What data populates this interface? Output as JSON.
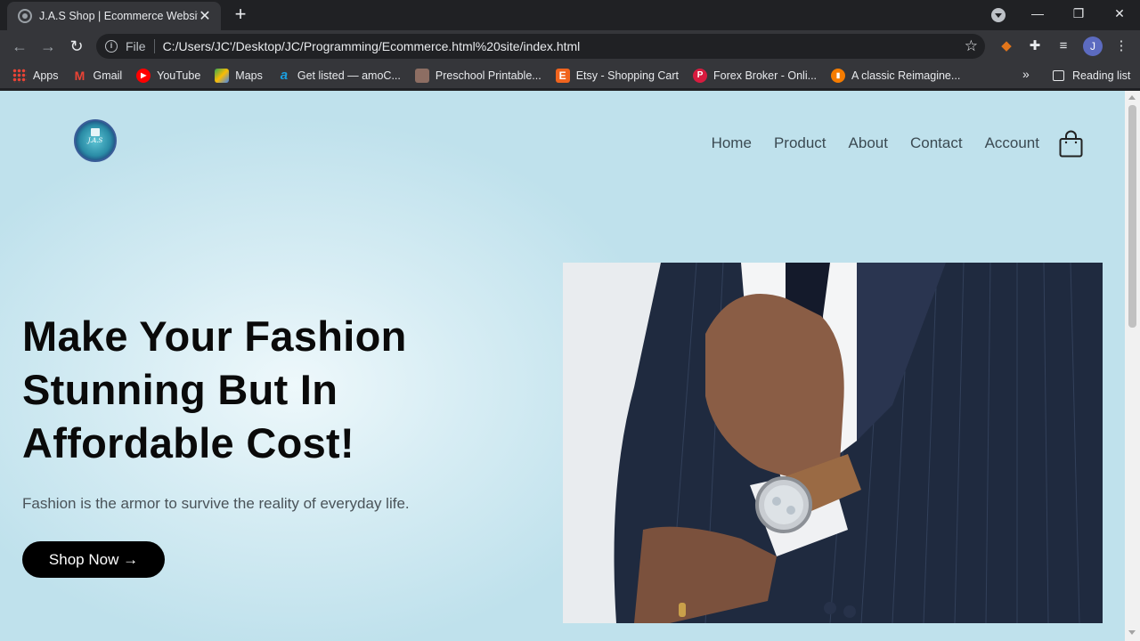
{
  "browser": {
    "tab_title": "J.A.S Shop | Ecommerce Website",
    "tab_close": "✕",
    "new_tab": "+",
    "window_controls": {
      "minimize": "—",
      "restore": "❐",
      "close": "✕"
    },
    "address": {
      "scheme_label": "File",
      "url": "C:/Users/JC'/Desktop/JC/Programming/Ecommerce.html%20site/index.html"
    },
    "profile_initial": "J",
    "bookmarks": [
      {
        "label": "Apps",
        "icon": "apps-grid-icon",
        "color": "#ea4335"
      },
      {
        "label": "Gmail",
        "icon": "gmail-icon",
        "color": "#ea4335"
      },
      {
        "label": "YouTube",
        "icon": "youtube-icon",
        "color": "#ff0000"
      },
      {
        "label": "Maps",
        "icon": "maps-icon",
        "color": "#34a853"
      },
      {
        "label": "Get listed — amoC...",
        "icon": "amocrm-icon",
        "color": "#1a73e8"
      },
      {
        "label": "Preschool Printable...",
        "icon": "preschool-icon",
        "color": "#8d6e63"
      },
      {
        "label": "Etsy - Shopping Cart",
        "icon": "etsy-icon",
        "color": "#f1641e"
      },
      {
        "label": "Forex Broker - Onli...",
        "icon": "forex-icon",
        "color": "#d81b3f"
      },
      {
        "label": "A classic Reimagine...",
        "icon": "classic-icon",
        "color": "#f57c00"
      }
    ],
    "bookmarks_overflow": "»",
    "reading_list": "Reading list"
  },
  "site": {
    "logo_text": "J.A.S",
    "nav": [
      "Home",
      "Product",
      "About",
      "Contact",
      "Account"
    ],
    "hero": {
      "headline": "Make Your Fashion Stunning But In Affordable Cost!",
      "subtitle": "Fashion is the armor to survive the reality of everyday life.",
      "cta": "Shop Now →"
    }
  }
}
